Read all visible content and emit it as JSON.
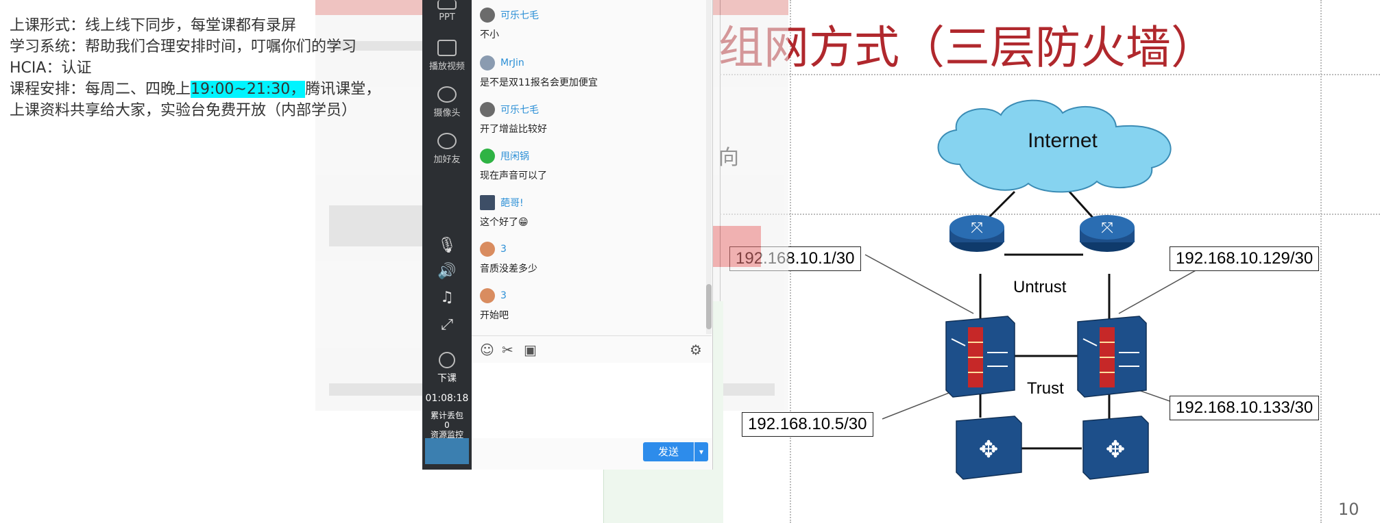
{
  "notes": {
    "line1": "上课形式：线上线下同步，每堂课都有录屏",
    "line2": "学习系统：帮助我们合理安排时间，叮嘱你们的学习",
    "line3": "HCIA：认证",
    "line4_pre": "课程安排：每周二、四晚上",
    "line4_time": "19:00~21:30，",
    "line4_post": "腾讯课堂，",
    "line5": "上课资料共享给大家，实验台免费开放（内部学员）"
  },
  "toolbar": {
    "ppt": "PPT",
    "play_video": "播放视频",
    "camera": "摄像头",
    "add_friend": "加好友",
    "end_class": "下课",
    "timer": "01:08:18",
    "packet_loss_label": "累计丢包",
    "packet_loss_value": "0",
    "resource_monitor": "资源监控"
  },
  "chat": {
    "messages": [
      {
        "nick": "可乐七毛",
        "text": "不小",
        "avatar_color": "#6b6b6b"
      },
      {
        "nick": "MrJin",
        "text": "是不是双11报名会更加便宜",
        "avatar_color": "#8a9bb0"
      },
      {
        "nick": "可乐七毛",
        "text": "开了增益比较好",
        "avatar_color": "#6b6b6b"
      },
      {
        "nick": "甩闲锅",
        "text": "现在声音可以了",
        "avatar_color": "#2fb344"
      },
      {
        "nick": "葩哥!",
        "text": "这个好了😁",
        "avatar_color": "#3d4e66"
      },
      {
        "nick": "3",
        "text": "音质没差多少",
        "avatar_color": "#d98c5f"
      },
      {
        "nick": "3",
        "text": "开始吧",
        "avatar_color": "#d98c5f"
      }
    ],
    "send_label": "发送",
    "tools": {
      "emoji": "☺",
      "scissors": "✂",
      "image": "▣",
      "settings": "⚙"
    }
  },
  "slide": {
    "title": "组网方式（三层防火墙）",
    "partial_text": "向",
    "cloud_label": "Internet",
    "zone_untrust": "Untrust",
    "zone_trust": "Trust",
    "ip_left_top": "192.168.10.1/30",
    "ip_right_top": "192.168.10.129/30",
    "ip_left_bottom": "192.168.10.5/30",
    "ip_right_bottom": "192.168.10.133/30",
    "page_number": "10"
  },
  "colors": {
    "title_red": "#b0282d",
    "highlight_cyan": "#00f4ff",
    "send_blue": "#2d8ceb",
    "nick_blue": "#2b8fd6",
    "toolbar_dark": "#2c2f33",
    "cloud_cyan": "#86d3f0",
    "device_blue": "#1d4f8a"
  }
}
